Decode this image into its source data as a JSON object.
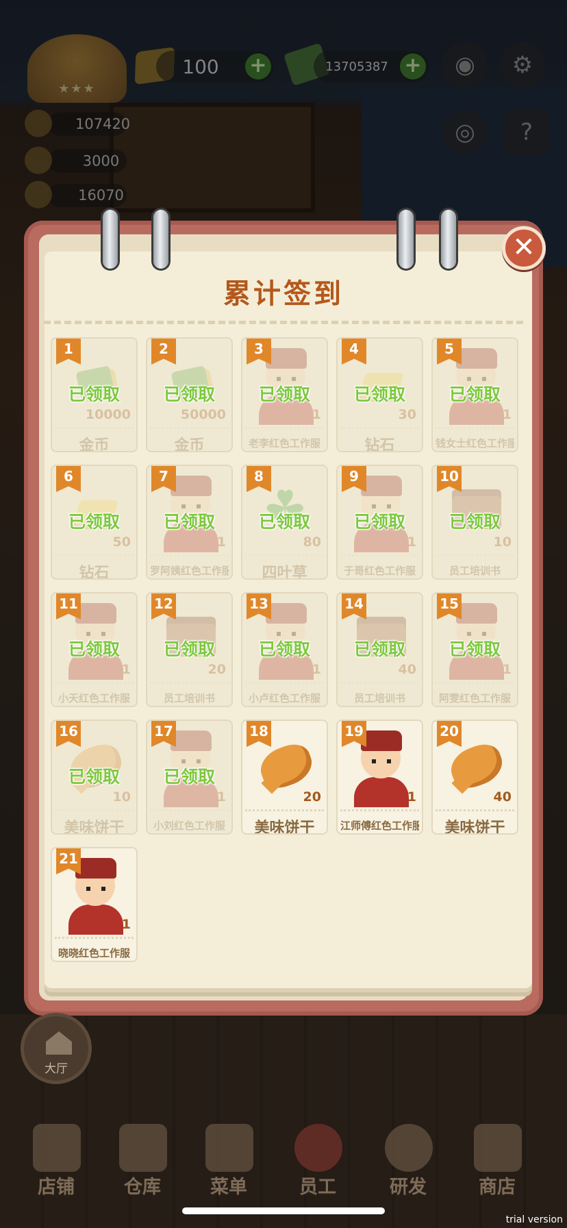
{
  "hud": {
    "gold_value": "100",
    "cash_value": "13705387",
    "plus_label": "+",
    "stats": [
      "107420",
      "3000",
      "16070"
    ]
  },
  "popup": {
    "title": "累计签到",
    "close_label": "✕",
    "claimed_label": "已领取",
    "rewards": [
      {
        "day": "1",
        "name": "金币",
        "qty": "10000",
        "icon": "gold-cash-icon",
        "claimed": true
      },
      {
        "day": "2",
        "name": "金币",
        "qty": "50000",
        "icon": "gold-cash-icon",
        "claimed": true
      },
      {
        "day": "3",
        "name": "老李红色工作服",
        "qty": "1",
        "icon": "staff-uniform-icon",
        "claimed": true
      },
      {
        "day": "4",
        "name": "钻石",
        "qty": "30",
        "icon": "diamond-icon",
        "claimed": true
      },
      {
        "day": "5",
        "name": "钱女士红色工作服",
        "qty": "1",
        "icon": "staff-uniform-icon",
        "claimed": true
      },
      {
        "day": "6",
        "name": "钻石",
        "qty": "50",
        "icon": "diamond-icon",
        "claimed": true
      },
      {
        "day": "7",
        "name": "罗阿姨红色工作服",
        "qty": "1",
        "icon": "staff-uniform-icon",
        "claimed": true
      },
      {
        "day": "8",
        "name": "四叶草",
        "qty": "80",
        "icon": "clover-icon",
        "claimed": true
      },
      {
        "day": "9",
        "name": "于哥红色工作服",
        "qty": "1",
        "icon": "staff-uniform-icon",
        "claimed": true
      },
      {
        "day": "10",
        "name": "员工培训书",
        "qty": "10",
        "icon": "training-book-icon",
        "claimed": true
      },
      {
        "day": "11",
        "name": "小天红色工作服",
        "qty": "1",
        "icon": "staff-uniform-icon",
        "claimed": true
      },
      {
        "day": "12",
        "name": "员工培训书",
        "qty": "20",
        "icon": "training-book-icon",
        "claimed": true
      },
      {
        "day": "13",
        "name": "小卢红色工作服",
        "qty": "1",
        "icon": "staff-uniform-icon",
        "claimed": true
      },
      {
        "day": "14",
        "name": "员工培训书",
        "qty": "40",
        "icon": "training-book-icon",
        "claimed": true
      },
      {
        "day": "15",
        "name": "阿雯红色工作服",
        "qty": "1",
        "icon": "staff-uniform-icon",
        "claimed": true
      },
      {
        "day": "16",
        "name": "美味饼干",
        "qty": "10",
        "icon": "fish-cookie-icon",
        "claimed": true
      },
      {
        "day": "17",
        "name": "小刘红色工作服",
        "qty": "1",
        "icon": "staff-uniform-icon",
        "claimed": true
      },
      {
        "day": "18",
        "name": "美味饼干",
        "qty": "20",
        "icon": "fish-cookie-icon",
        "claimed": false
      },
      {
        "day": "19",
        "name": "江师傅红色工作服",
        "qty": "1",
        "icon": "staff-uniform-icon",
        "claimed": false
      },
      {
        "day": "20",
        "name": "美味饼干",
        "qty": "40",
        "icon": "fish-cookie-icon",
        "claimed": false
      },
      {
        "day": "21",
        "name": "晓晓红色工作服",
        "qty": "1",
        "icon": "staff-uniform-icon",
        "claimed": false
      }
    ]
  },
  "home_button": {
    "label": "大厅"
  },
  "tabs": [
    {
      "label": "店铺",
      "icon": "shop-icon"
    },
    {
      "label": "仓库",
      "icon": "warehouse-icon"
    },
    {
      "label": "菜单",
      "icon": "menu-icon"
    },
    {
      "label": "员工",
      "icon": "staff-icon"
    },
    {
      "label": "研发",
      "icon": "research-icon"
    },
    {
      "label": "商店",
      "icon": "store-icon"
    }
  ],
  "watermark": "trial version",
  "colors": {
    "accent": "#e0872a",
    "title": "#b4581c",
    "claimed_green": "#7dc83e",
    "close_red": "#c95a3d"
  }
}
